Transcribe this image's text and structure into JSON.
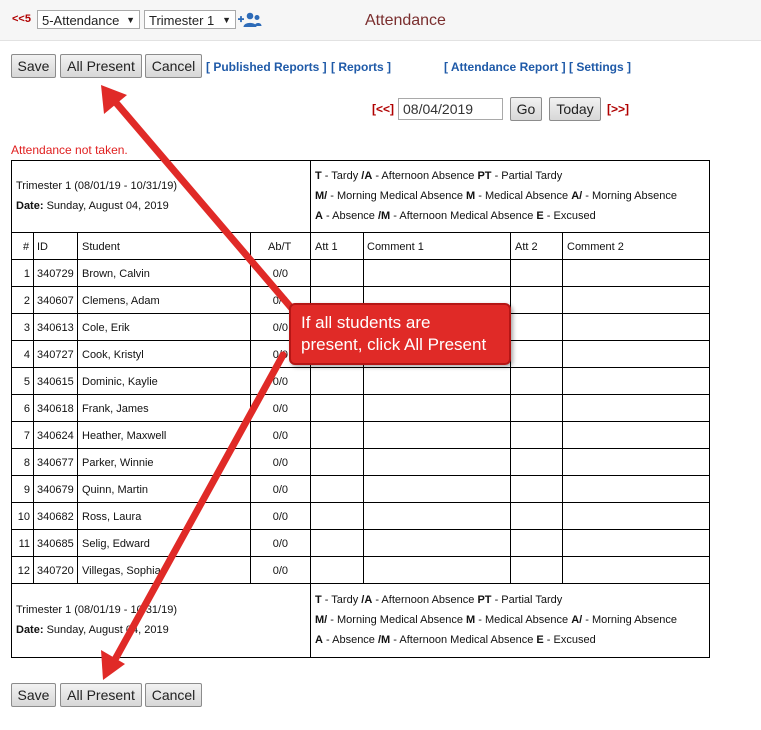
{
  "top_bar": {
    "prev_label": "<<5",
    "class_select": "5-Attendance",
    "term_select": "Trimester 1",
    "title": "Attendance"
  },
  "toolbar": {
    "save": "Save",
    "all_present": "All Present",
    "cancel": "Cancel",
    "published_reports": "[ Published Reports ]",
    "reports": "[ Reports ]",
    "attendance_report": "[ Attendance Report ]",
    "settings": "[ Settings ]"
  },
  "date_nav": {
    "prev": "[<<]",
    "date": "08/04/2019",
    "go": "Go",
    "today": "Today",
    "next": "[>>]"
  },
  "notice": "Attendance not taken.",
  "term_info": {
    "term": "Trimester 1 (08/01/19 - 10/31/19)",
    "date_label": "Date:",
    "date_value": " Sunday, August 04, 2019"
  },
  "legend": {
    "line1": [
      {
        "code": "T",
        "desc": " - Tardy  "
      },
      {
        "code": "/A",
        "desc": " - Afternoon Absence  "
      },
      {
        "code": "PT",
        "desc": " - Partial Tardy"
      }
    ],
    "line2": [
      {
        "code": "M/",
        "desc": " - Morning Medical Absence  "
      },
      {
        "code": "M",
        "desc": " - Medical Absence  "
      },
      {
        "code": "A/",
        "desc": " - Morning Absence"
      }
    ],
    "line3": [
      {
        "code": "A",
        "desc": " - Absence  "
      },
      {
        "code": "/M",
        "desc": " - Afternoon Medical Absence  "
      },
      {
        "code": "E",
        "desc": " - Excused"
      }
    ]
  },
  "columns": [
    "#",
    "ID",
    "Student",
    "Ab/T",
    "Att 1",
    "Comment 1",
    "Att 2",
    "Comment 2"
  ],
  "students": [
    {
      "n": "1",
      "id": "340729",
      "name": "Brown, Calvin",
      "abt": "0/0"
    },
    {
      "n": "2",
      "id": "340607",
      "name": "Clemens, Adam",
      "abt": "0/0"
    },
    {
      "n": "3",
      "id": "340613",
      "name": "Cole, Erik",
      "abt": "0/0"
    },
    {
      "n": "4",
      "id": "340727",
      "name": "Cook, Kristyl",
      "abt": "0/0"
    },
    {
      "n": "5",
      "id": "340615",
      "name": "Dominic, Kaylie",
      "abt": "0/0"
    },
    {
      "n": "6",
      "id": "340618",
      "name": "Frank, James",
      "abt": "0/0"
    },
    {
      "n": "7",
      "id": "340624",
      "name": "Heather, Maxwell",
      "abt": "0/0"
    },
    {
      "n": "8",
      "id": "340677",
      "name": "Parker, Winnie",
      "abt": "0/0"
    },
    {
      "n": "9",
      "id": "340679",
      "name": "Quinn, Martin",
      "abt": "0/0"
    },
    {
      "n": "10",
      "id": "340682",
      "name": "Ross, Laura",
      "abt": "0/0"
    },
    {
      "n": "11",
      "id": "340685",
      "name": "Selig, Edward",
      "abt": "0/0"
    },
    {
      "n": "12",
      "id": "340720",
      "name": "Villegas, Sophia",
      "abt": "0/0"
    }
  ],
  "callout": {
    "line1": "If all students are",
    "line2": "present, click All Present"
  },
  "icons": {
    "add_students": "people-add-icon"
  },
  "colors": {
    "link": "#1f5aa8",
    "warning": "#e02020",
    "callout": "#e02a27",
    "nav_red": "#b00000"
  }
}
